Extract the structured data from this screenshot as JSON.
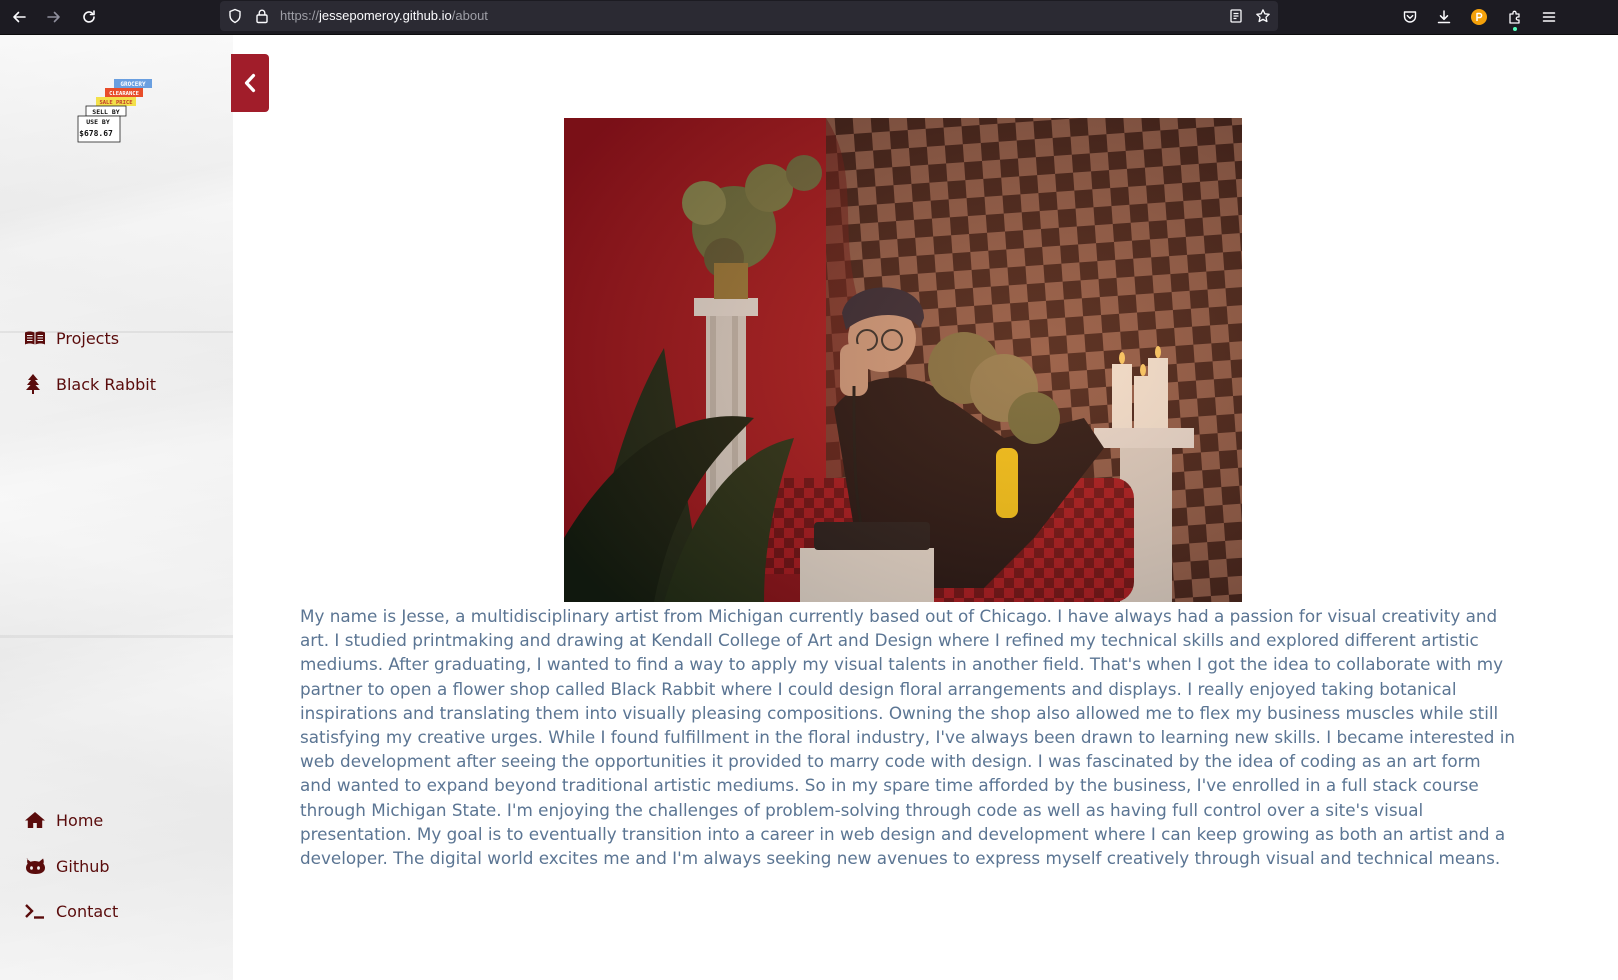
{
  "browser": {
    "url_scheme": "https://",
    "url_host": "jessepomeroy.github.io",
    "url_path": "/about"
  },
  "icons": {
    "back": "arrow-left-icon",
    "forward": "arrow-right-icon",
    "reload": "reload-icon",
    "shield": "shield-icon",
    "lock": "lock-icon",
    "reader": "reader-view-icon",
    "bookmark": "star-icon",
    "pocket": "pocket-icon",
    "downloads": "download-icon",
    "profile": "profile-avatar-icon",
    "extensions": "puzzle-icon",
    "menu": "hamburger-menu-icon",
    "sidebar_toggle": "chevron-left-icon"
  },
  "logo": {
    "tags": [
      "GROCERY",
      "CLEARANCE",
      "SALE PRICE",
      "SELL BY",
      "USE BY",
      "$678.67"
    ]
  },
  "sidebar": {
    "top_items": [
      {
        "label": "Projects",
        "icon": "book-open-icon"
      },
      {
        "label": "Black Rabbit",
        "icon": "tree-icon"
      }
    ],
    "bottom_items": [
      {
        "label": "Home",
        "icon": "home-icon"
      },
      {
        "label": "Github",
        "icon": "github-icon"
      },
      {
        "label": "Contact",
        "icon": "terminal-icon"
      }
    ]
  },
  "colors": {
    "accent": "#a11d2a",
    "nav_text": "#5a0c0c",
    "body_text": "#5b7593",
    "chrome_bg": "#1c1b22"
  },
  "main": {
    "bio": "My name is Jesse, a multidisciplinary artist from Michigan currently based out of Chicago. I have always had a passion for visual creativity and art. I studied printmaking and drawing at Kendall College of Art and Design where I refined my technical skills and explored different artistic mediums. After graduating, I wanted to find a way to apply my visual talents in another field. That's when I got the idea to collaborate with my partner to open a flower shop called Black Rabbit where I could design floral arrangements and displays. I really enjoyed taking botanical inspirations and translating them into visually pleasing compositions. Owning the shop also allowed me to flex my business muscles while still satisfying my creative urges. While I found fulfillment in the floral industry, I've always been drawn to learning new skills. I became interested in web development after seeing the opportunities it provided to marry code with design. I was fascinated by the idea of coding as an art form and wanted to expand beyond traditional artistic mediums. So in my spare time afforded by the business, I've enrolled in a full stack course through Michigan State. I'm enjoying the challenges of problem-solving through code as well as having full control over a site's visual presentation. My goal is to eventually transition into a career in web design and development where I can keep growing as both an artist and a developer. The digital world excites me and I'm always seeking new avenues to express myself creatively through visual and technical means."
  }
}
